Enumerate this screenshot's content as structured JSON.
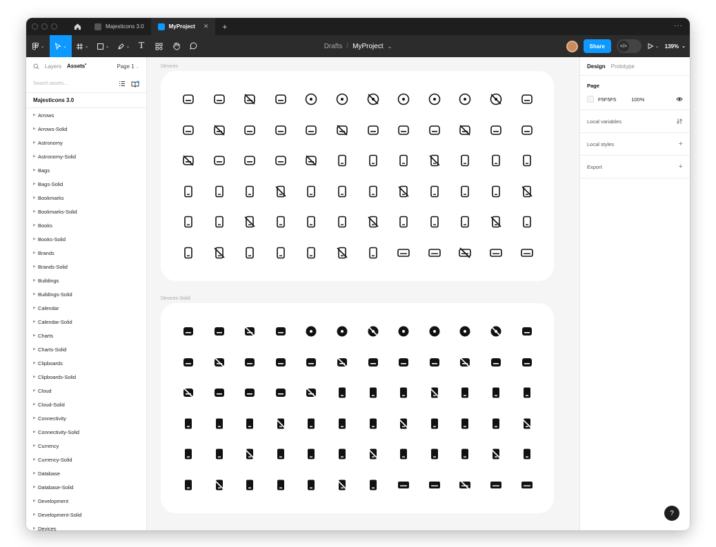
{
  "titlebar": {
    "tabs": [
      {
        "label": "Majesticons 3.0",
        "active": false,
        "close": ""
      },
      {
        "label": "MyProject",
        "active": true,
        "close": "✕"
      }
    ],
    "add_label": "+",
    "more_label": "···"
  },
  "toolbar": {
    "breadcrumb_parent": "Drafts",
    "breadcrumb_separator": "/",
    "file_name": "MyProject",
    "share_label": "Share",
    "dev_mode_label": "</>",
    "zoom": "139%",
    "tools": [
      "main-menu",
      "move",
      "frame",
      "shape",
      "pen",
      "text",
      "resources",
      "hand",
      "comment"
    ]
  },
  "left_panel": {
    "tab_layers": "Layers",
    "tab_assets": "Assets",
    "page_selector": "Page 1",
    "search_placeholder": "Search assets...",
    "library_title": "Majesticons 3.0",
    "items": [
      "Arrows",
      "Arrows-Solid",
      "Astronomy",
      "Astronomy-Solid",
      "Bags",
      "Bags-Solid",
      "Bookmarks",
      "Bookmarks-Solid",
      "Books",
      "Books-Solid",
      "Brands",
      "Brands-Solid",
      "Buildings",
      "Buildings-Solid",
      "Calendar",
      "Calendar-Solid",
      "Charts",
      "Charts-Solid",
      "Clipboards",
      "Clipboards-Solid",
      "Cloud",
      "Cloud-Solid",
      "Connectivity",
      "Connectivity-Solid",
      "Currency",
      "Currency-Solid",
      "Database",
      "Database-Solid",
      "Development",
      "Development-Solid",
      "Devices"
    ]
  },
  "canvas": {
    "frames": [
      {
        "label": "Devices",
        "style": "line"
      },
      {
        "label": "Devices-Solid",
        "style": "solid"
      }
    ],
    "icon_names": [
      [
        "camera-device",
        "hard-drive",
        "hard-drive-off",
        "printer",
        "disc",
        "vinyl",
        "disc-scan",
        "disc-off",
        "disc-alt",
        "disc-alt-off",
        "cpu",
        "cpu-off"
      ],
      [
        "cpu-settings",
        "usb-drive",
        "printer-alt",
        "floppy",
        "floppy-alt",
        "tablet-stand",
        "drive",
        "drive-dots",
        "inbox-download",
        "tablet-slash",
        "tablet-download",
        "radio"
      ],
      [
        "radio-round",
        "sim-off",
        "device-download",
        "headphones",
        "headphones-charge",
        "headphones-alt",
        "headphones-off",
        "phone-nfc",
        "wifi-router",
        "phone",
        "phone-keypad",
        "phone-speaker"
      ],
      [
        "phone-sync",
        "phone-transfer",
        "phone-swap",
        "calculator",
        "calculator-alt",
        "phone-off",
        "phone-dots",
        "phone-sim",
        "phone-exit",
        "phone-cast",
        "phone-notch",
        "phone-rounded"
      ],
      [
        "phone-large",
        "phone-list",
        "phone-grid",
        "phone-flip",
        "phone-full",
        "phone-repeat",
        "phone-arrows",
        "phone-alert",
        "phone-rotate",
        "phone-qr",
        "phone-lines",
        "phone-cross"
      ],
      [
        "phone-more",
        "phone-card",
        "phone-share",
        "phone-wireless",
        "phone-basic",
        "phone-notes",
        "phone-home",
        "keyboard",
        "keyboard-small",
        "keyboard-stand",
        "keyboard-bubble",
        "keyboard-off"
      ]
    ]
  },
  "right_panel": {
    "tab_design": "Design",
    "tab_prototype": "Prototype",
    "page_section": "Page",
    "page_color": "F5F5F5",
    "page_opacity": "100%",
    "local_variables": "Local variables",
    "local_styles": "Local styles",
    "export": "Export",
    "add_symbol": "+",
    "help_label": "?"
  },
  "colors": {
    "accent": "#0d99ff",
    "toolbar_bg": "#2c2c2c",
    "titlebar_bg": "#1e1e1e",
    "canvas_bg": "#f5f5f5"
  }
}
